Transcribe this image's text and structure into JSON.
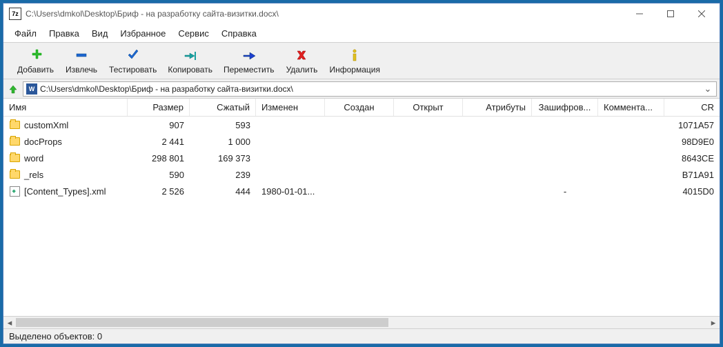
{
  "title": "C:\\Users\\dmkol\\Desktop\\Бриф - на разработку сайта-визитки.docx\\",
  "menu": [
    "Файл",
    "Правка",
    "Вид",
    "Избранное",
    "Сервис",
    "Справка"
  ],
  "toolbar": [
    {
      "label": "Добавить",
      "icon": "plus",
      "color": "#2fb82f"
    },
    {
      "label": "Извлечь",
      "icon": "minus",
      "color": "#1e66d0"
    },
    {
      "label": "Тестировать",
      "icon": "check",
      "color": "#1e66d0"
    },
    {
      "label": "Копировать",
      "icon": "copy",
      "color": "#1aa0a0"
    },
    {
      "label": "Переместить",
      "icon": "move",
      "color": "#1e3fd0"
    },
    {
      "label": "Удалить",
      "icon": "delete",
      "color": "#e02020"
    },
    {
      "label": "Информация",
      "icon": "info",
      "color": "#e0c020"
    }
  ],
  "path": "C:\\Users\\dmkol\\Desktop\\Бриф - на разработку сайта-визитки.docx\\",
  "columns": {
    "name": "Имя",
    "size": "Размер",
    "packed": "Сжатый",
    "modified": "Изменен",
    "created": "Создан",
    "access": "Открыт",
    "attr": "Атрибуты",
    "enc": "Зашифров...",
    "comment": "Коммента...",
    "crc": "CR"
  },
  "rows": [
    {
      "type": "folder",
      "name": "customXml",
      "size": "907",
      "packed": "593",
      "modified": "",
      "enc": "",
      "crc": "1071A57"
    },
    {
      "type": "folder",
      "name": "docProps",
      "size": "2 441",
      "packed": "1 000",
      "modified": "",
      "enc": "",
      "crc": "98D9E0"
    },
    {
      "type": "folder",
      "name": "word",
      "size": "298 801",
      "packed": "169 373",
      "modified": "",
      "enc": "",
      "crc": "8643CE"
    },
    {
      "type": "folder",
      "name": "_rels",
      "size": "590",
      "packed": "239",
      "modified": "",
      "enc": "",
      "crc": "B71A91"
    },
    {
      "type": "file",
      "name": "[Content_Types].xml",
      "size": "2 526",
      "packed": "444",
      "modified": "1980-01-01...",
      "enc": "-",
      "crc": "4015D0"
    }
  ],
  "status": "Выделено объектов: 0"
}
